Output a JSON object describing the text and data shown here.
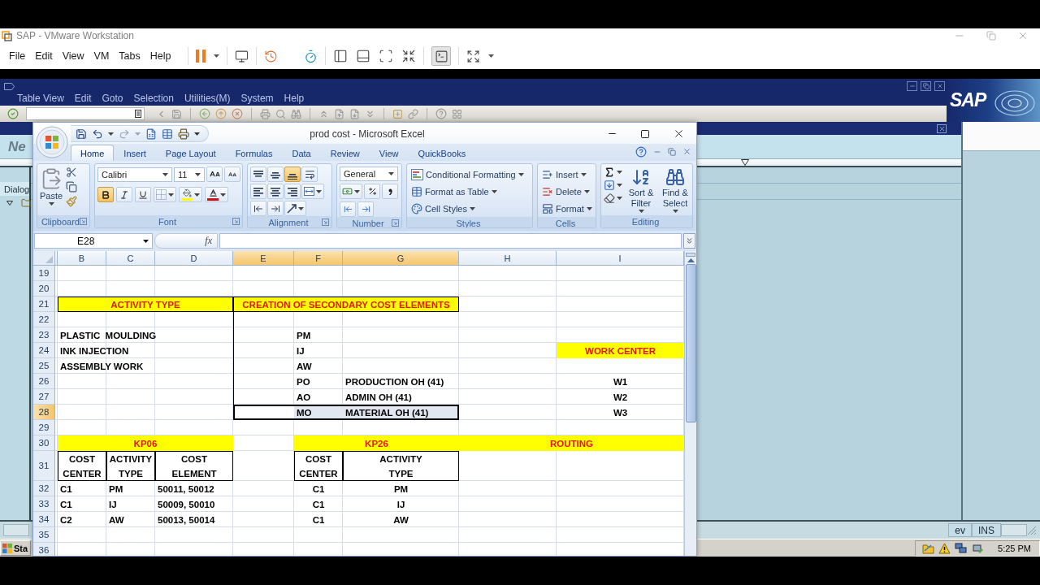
{
  "vm_window": {
    "title": "SAP - VMware Workstation",
    "menu": [
      "File",
      "Edit",
      "View",
      "VM",
      "Tabs",
      "Help"
    ],
    "console_view_on": true
  },
  "sap": {
    "menu": [
      "Table View",
      "Edit",
      "Goto",
      "Selection",
      "Utilities(M)",
      "System",
      "Help"
    ],
    "logo": "SAP",
    "screen_title": "Ne",
    "pane_title": "Dialog",
    "status_fields": [
      "ev",
      "INS"
    ]
  },
  "excel": {
    "title": "prod cost - Microsoft Excel",
    "tabs": [
      {
        "label": "Home",
        "selected": true
      },
      {
        "label": "Insert",
        "selected": false
      },
      {
        "label": "Page Layout",
        "selected": false
      },
      {
        "label": "Formulas",
        "selected": false
      },
      {
        "label": "Data",
        "selected": false
      },
      {
        "label": "Review",
        "selected": false
      },
      {
        "label": "View",
        "selected": false
      },
      {
        "label": "QuickBooks",
        "selected": false
      }
    ],
    "ribbon": {
      "clipboard": {
        "label": "Clipboard",
        "paste": "Paste"
      },
      "font": {
        "label": "Font",
        "name": "Calibri",
        "size": "11",
        "styles": [
          {
            "kind": "bold",
            "selected": true
          },
          {
            "kind": "italic",
            "selected": false
          },
          {
            "kind": "underline",
            "selected": false
          }
        ]
      },
      "alignment": {
        "label": "Alignment",
        "vertical": [
          {
            "kind": "top",
            "selected": false
          },
          {
            "kind": "middle",
            "selected": false
          },
          {
            "kind": "bottom",
            "selected": true
          }
        ],
        "horizontal": [
          {
            "kind": "left",
            "selected": false
          },
          {
            "kind": "center",
            "selected": false
          },
          {
            "kind": "right",
            "selected": false
          }
        ]
      },
      "number": {
        "label": "Number",
        "format": "General"
      },
      "styles": {
        "label": "Styles",
        "commands": [
          "Conditional Formatting",
          "Format as Table",
          "Cell Styles"
        ]
      },
      "cells": {
        "label": "Cells",
        "commands": [
          "Insert",
          "Delete",
          "Format"
        ]
      },
      "editing": {
        "label": "Editing",
        "commands": [
          "Sort & Filter",
          "Find & Select"
        ]
      }
    },
    "formula_bar": {
      "name_box": "E28",
      "function_label": "fx"
    },
    "sheet": {
      "columns": [
        {
          "selected": false
        },
        {
          "label": "B",
          "selected": false
        },
        {
          "label": "C",
          "selected": false
        },
        {
          "label": "D",
          "selected": false
        },
        {
          "label": "E",
          "selected": true
        },
        {
          "label": "F",
          "selected": true
        },
        {
          "label": "G",
          "selected": true
        },
        {
          "label": "H",
          "selected": false
        },
        {
          "label": "I",
          "selected": false
        }
      ],
      "rows": [
        {
          "label": "19",
          "selected": false
        },
        {
          "label": "20",
          "selected": false
        },
        {
          "label": "21",
          "selected": false
        },
        {
          "label": "22",
          "selected": false
        },
        {
          "label": "23",
          "selected": false
        },
        {
          "label": "24",
          "selected": false
        },
        {
          "label": "25",
          "selected": false
        },
        {
          "label": "26",
          "selected": false
        },
        {
          "label": "27",
          "selected": false
        },
        {
          "label": "28",
          "selected": true
        },
        {
          "label": "29",
          "selected": false
        },
        {
          "label": "30",
          "selected": false
        },
        {
          "label": "31",
          "selected": false
        },
        {
          "label": "32",
          "selected": false
        },
        {
          "label": "33",
          "selected": false
        },
        {
          "label": "34",
          "selected": false
        },
        {
          "label": "35",
          "selected": false
        },
        {
          "label": "36",
          "selected": false
        }
      ],
      "activity_type": {
        "title": "ACTIVITY TYPE",
        "items": [
          "PLASTIC  MOULDING",
          "INK INJECTION",
          "ASSEMBLY WORK"
        ]
      },
      "secondary_cost_elements": {
        "title": "CREATION OF SECONDARY COST ELEMENTS",
        "items": [
          {
            "code": "PM"
          },
          {
            "code": "IJ"
          },
          {
            "code": "AW"
          },
          {
            "code": "PO",
            "name": "PRODUCTION OH (41)"
          },
          {
            "code": "AO",
            "name": "ADMIN OH (41)"
          },
          {
            "code": "MO",
            "name": "MATERIAL OH (41)"
          }
        ]
      },
      "work_center": {
        "title": "WORK CENTER",
        "items": [
          "W1",
          "W2",
          "W3"
        ]
      },
      "kp06": {
        "title": "KP06",
        "headers": [
          "COST CENTER",
          "ACTIVITY TYPE",
          "COST ELEMENT"
        ],
        "rows": [
          [
            "C1",
            "PM",
            "50011, 50012"
          ],
          [
            "C1",
            "IJ",
            "50009, 50010"
          ],
          [
            "C2",
            "AW",
            "50013, 50014"
          ]
        ]
      },
      "kp26": {
        "title": "KP26",
        "headers": [
          "COST CENTER",
          "ACTIVITY TYPE"
        ],
        "rows": [
          [
            "C1",
            "PM"
          ],
          [
            "C1",
            "IJ"
          ],
          [
            "C1",
            "AW"
          ]
        ]
      },
      "routing": {
        "title": "ROUTING"
      }
    }
  },
  "taskbar": {
    "start": "Sta",
    "clock": "5:25 PM"
  }
}
